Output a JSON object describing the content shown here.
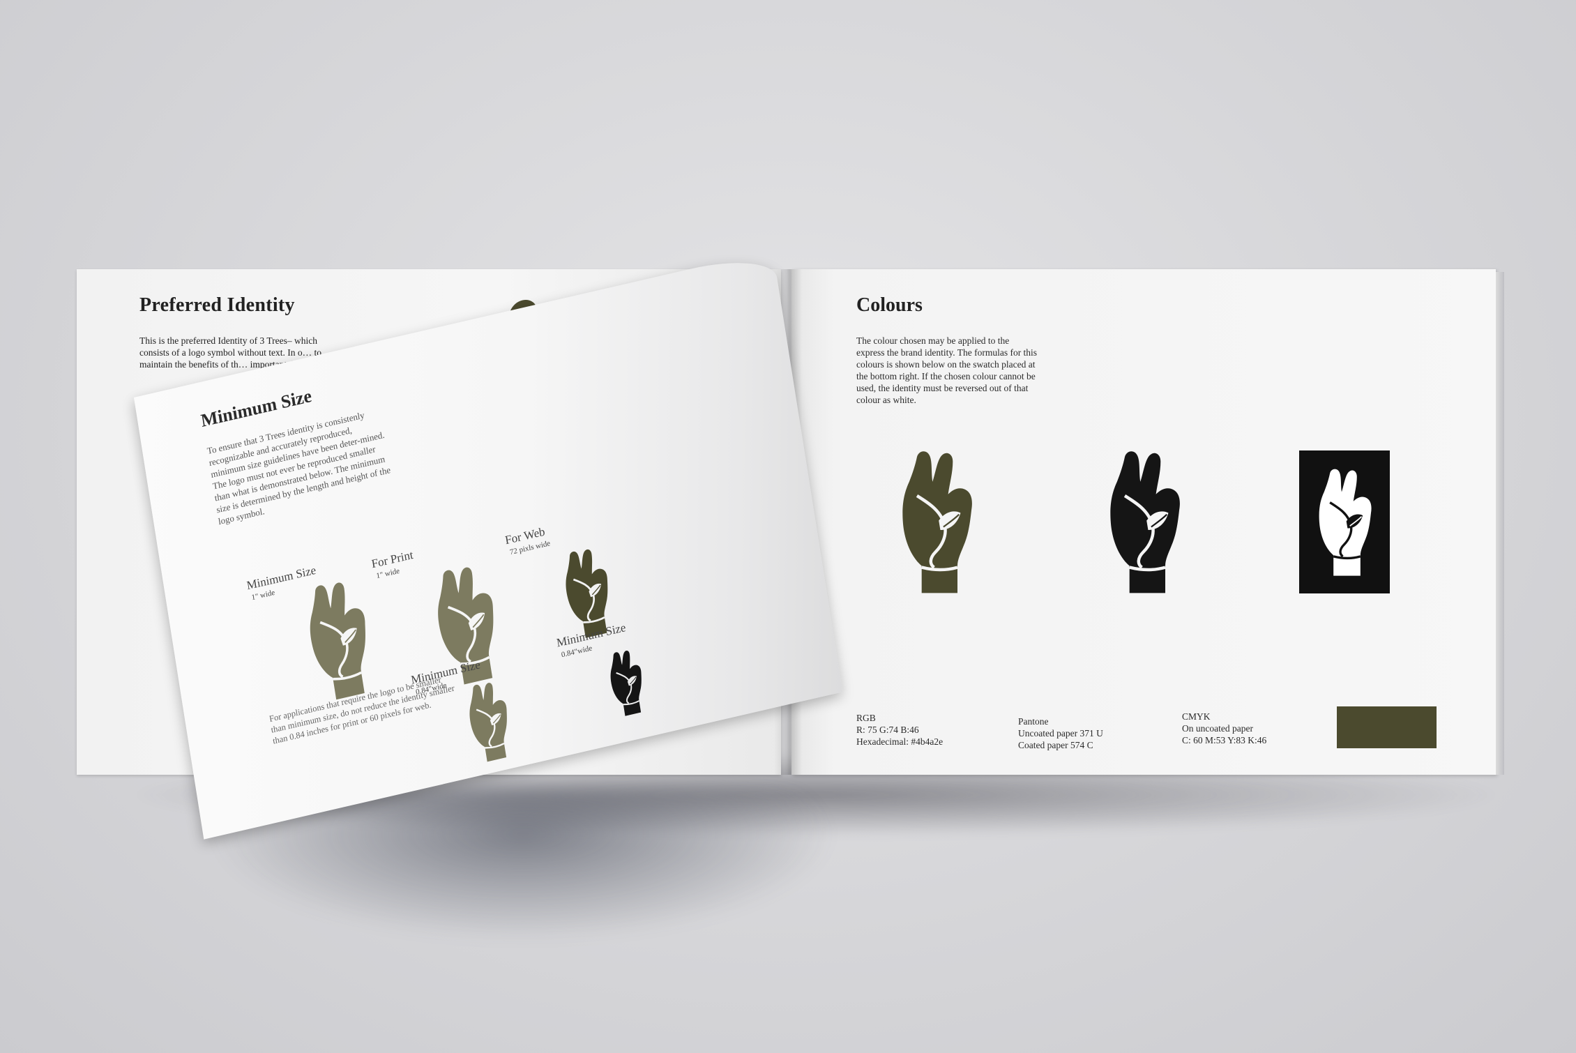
{
  "left_page": {
    "title": "Preferred Identity",
    "body": "This is the preferred Identity of 3 Trees– which consists of a logo symbol without text. In o… to maintain the benefits of th… important that…"
  },
  "flip_page": {
    "title": "Minimum Size",
    "body": "To ensure that 3 Trees identity is consistenly recognizable and accurately reproduced, minimum size guidelines have been deter-mined. The logo must not ever be reproduced smaller than what is demonstrated below. The minimum size is determined by the length and height of the logo symbol.",
    "items": [
      {
        "label": "Minimum Size",
        "sub": "1\" wide"
      },
      {
        "label": "For Print",
        "sub": "1\" wide"
      },
      {
        "label": "For Web",
        "sub": "72 pixls wide"
      },
      {
        "label": "Minimum Size",
        "sub": "0.84\"wide"
      },
      {
        "label": "Minimum Size",
        "sub": "0.84\"wide"
      }
    ],
    "note": "For applications that require the logo to be smaller than minimum size, do not reduce the identity smaller than 0.84 inches for print or 60 pixels for web."
  },
  "right_page": {
    "title": "Colours",
    "body": "The colour chosen may be applied to the express the brand identity. The formulas for this colours is shown below on the swatch placed at the bottom right. If the chosen colour cannot be used, the identity must be reversed out of that colour as white.",
    "rgb": {
      "heading": "RGB",
      "line1": "R: 75 G:74 B:46",
      "line2": "Hexadecimal: #4b4a2e"
    },
    "pantone": {
      "heading": "Pantone",
      "line1": "Uncoated paper 371 U",
      "line2": "Coated paper 574 C"
    },
    "cmyk": {
      "heading": "CMYK",
      "line1": "On uncoated paper",
      "line2": "C: 60 M:53 Y:83 K:46"
    }
  },
  "colors": {
    "brand": "#4b4a2e",
    "brand_light": "#7d7b60",
    "black": "#151515",
    "white": "#ffffff"
  },
  "icons": [
    "hand-leaf-logo-icon"
  ]
}
